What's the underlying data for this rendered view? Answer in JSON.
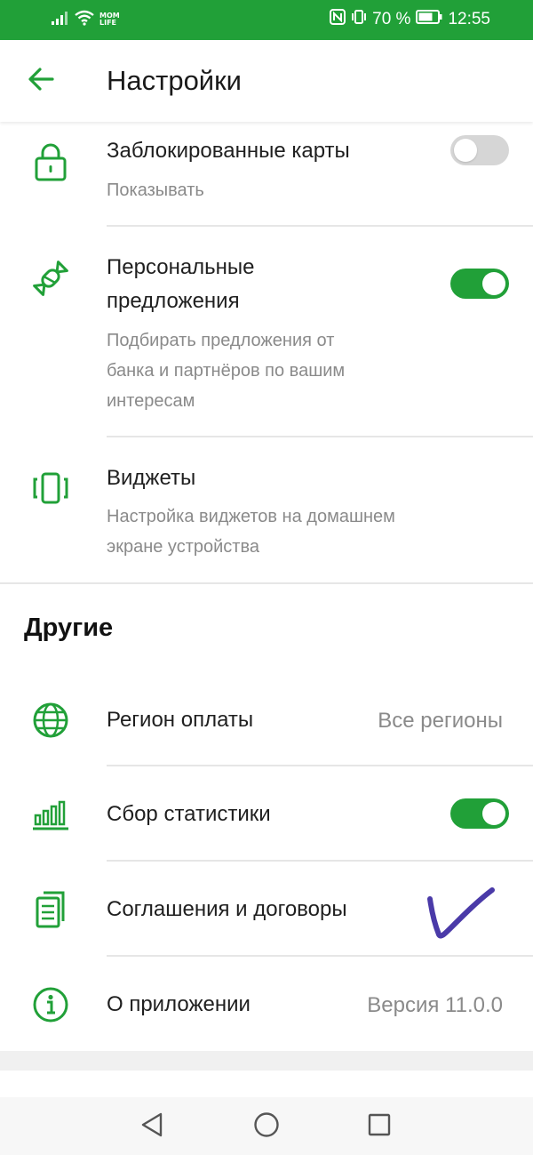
{
  "status_bar": {
    "carrier_line1": "MOM",
    "carrier_line2": "LIFE",
    "battery": "70 %",
    "time": "12:55"
  },
  "header": {
    "title": "Настройки"
  },
  "settings": {
    "blocked_cards": {
      "title": "Заблокированные карты",
      "subtitle": "Показывать",
      "enabled": false,
      "icon": "lock-icon"
    },
    "personal_offers": {
      "title_line1": "Персональные",
      "title_line2": "предложения",
      "subtitle_line1": "Подбирать предложения от",
      "subtitle_line2": "банка и партнёров по вашим",
      "subtitle_line3": "интересам",
      "enabled": true,
      "icon": "candy-icon"
    },
    "widgets": {
      "title": "Виджеты",
      "subtitle_line1": "Настройка виджетов на домашнем",
      "subtitle_line2": "экране устройства",
      "icon": "phone-vibrate-icon"
    }
  },
  "others": {
    "section_title": "Другие",
    "payment_region": {
      "title": "Регион оплаты",
      "value": "Все регионы",
      "icon": "globe-icon"
    },
    "statistics": {
      "title": "Сбор статистики",
      "enabled": true,
      "icon": "bar-chart-icon"
    },
    "agreements": {
      "title": "Соглашения и договоры",
      "icon": "documents-icon"
    },
    "about": {
      "title": "О приложении",
      "value": "Версия 11.0.0",
      "icon": "info-icon"
    }
  },
  "colors": {
    "accent": "#21a038",
    "annotation": "#4a3aa8"
  }
}
